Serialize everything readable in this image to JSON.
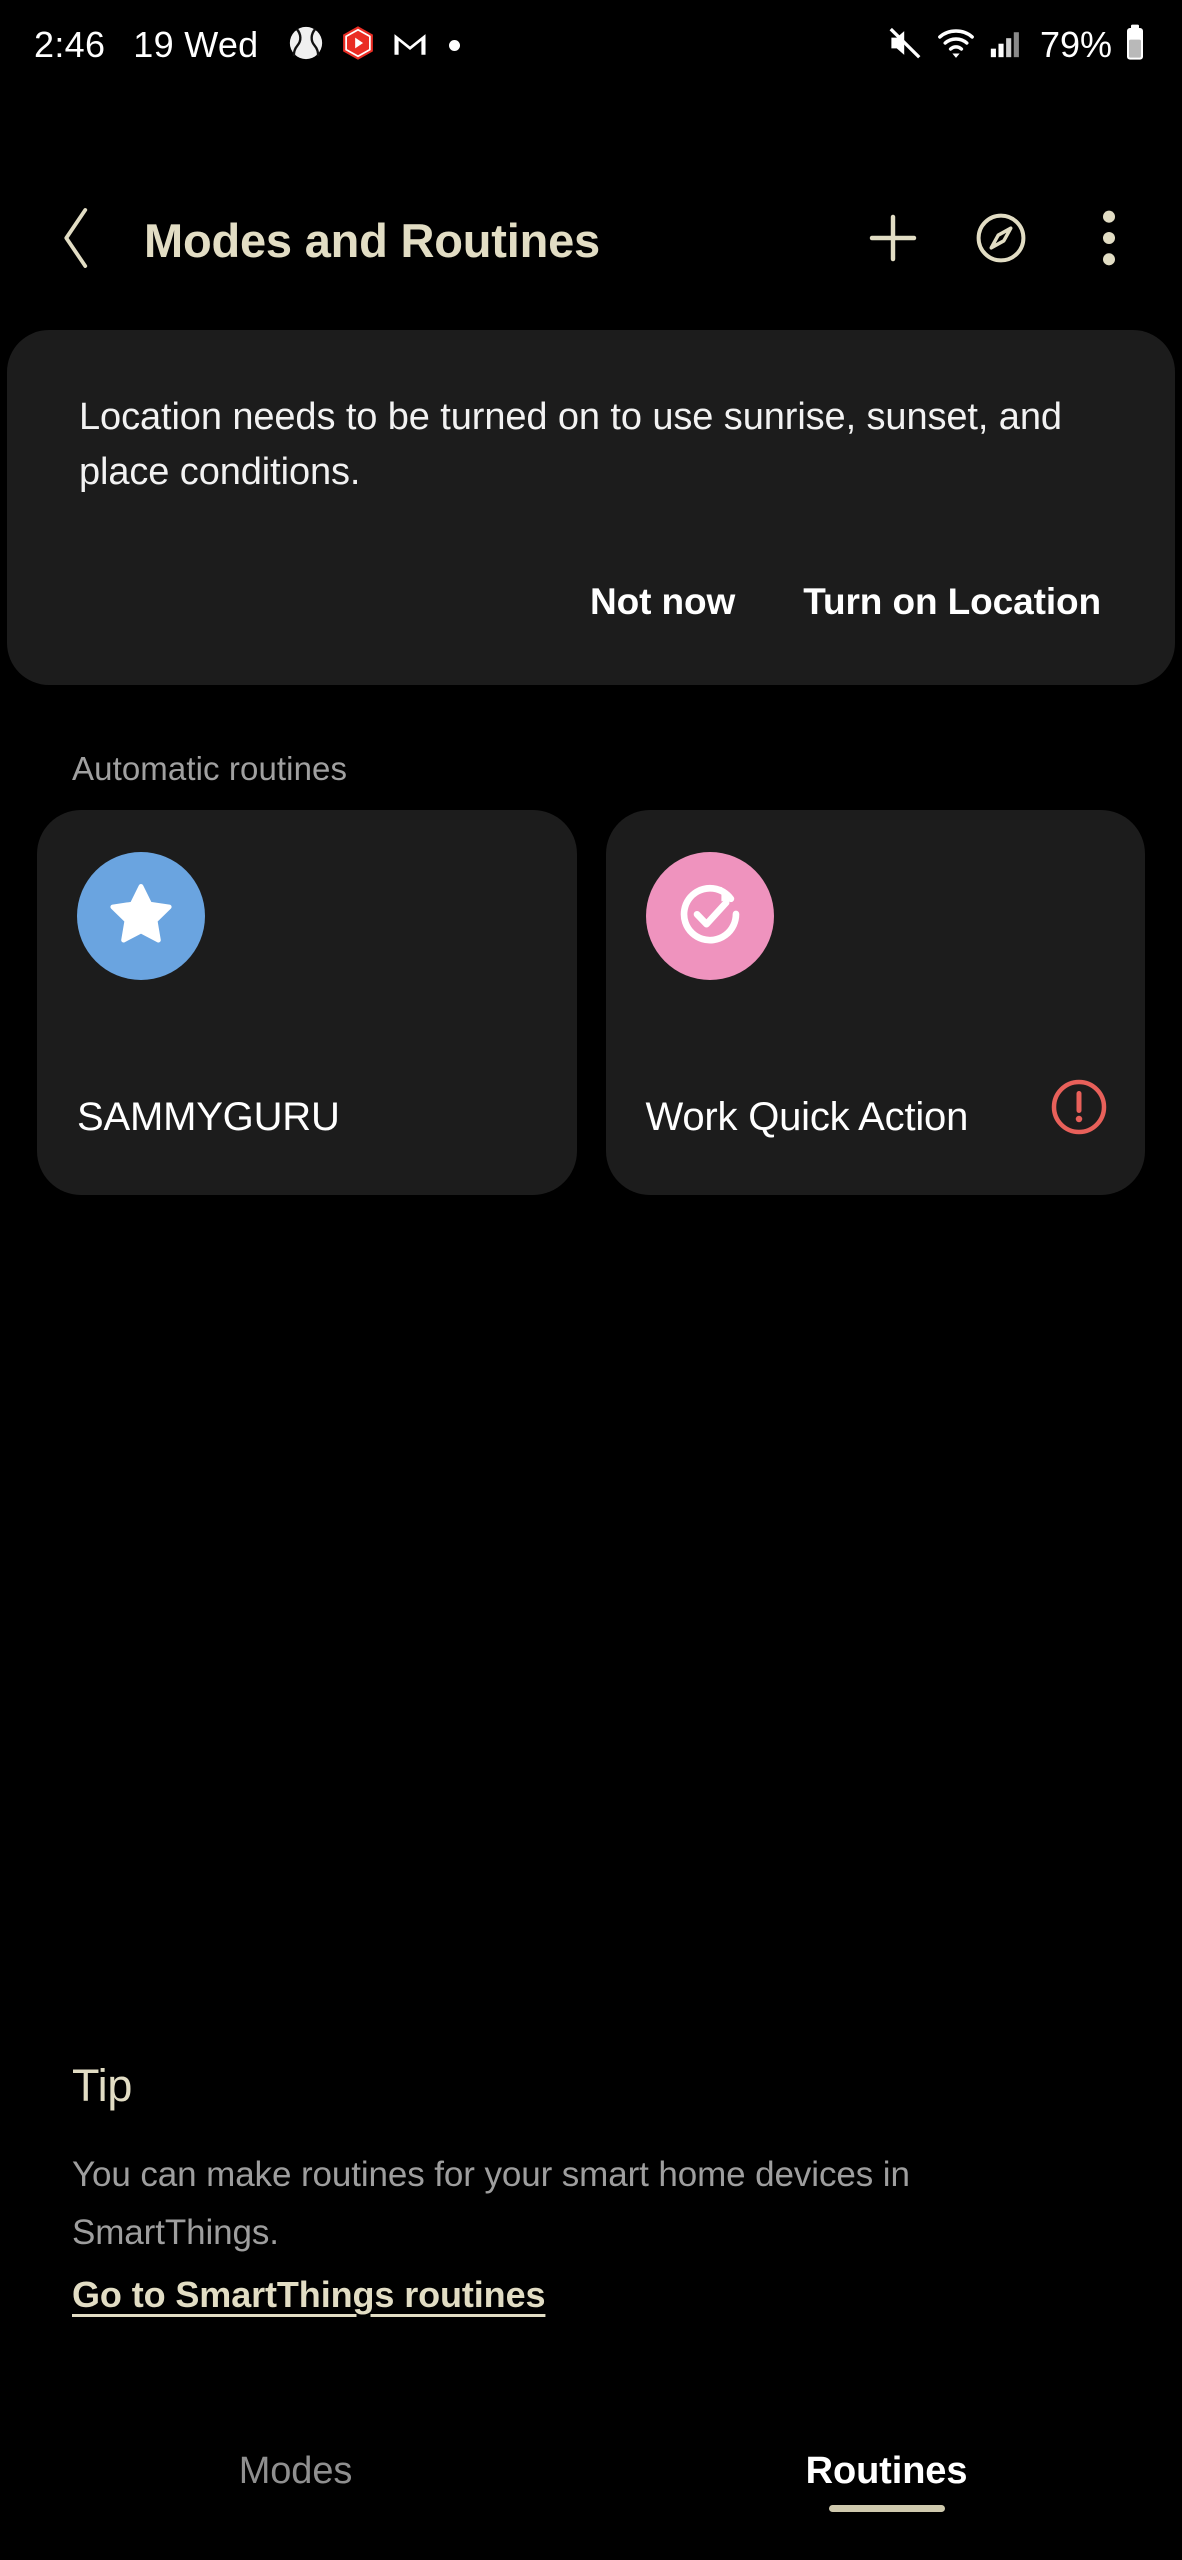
{
  "status_bar": {
    "time": "2:46",
    "date": "19 Wed",
    "battery_percent": "79%",
    "left_icons": [
      "sports-baseball-icon",
      "youtube-play-icon",
      "gmail-icon",
      "more-notifications-dot"
    ],
    "right_icons": [
      "mute-icon",
      "wifi-icon",
      "cellular-signal-icon",
      "battery-icon"
    ]
  },
  "header": {
    "title": "Modes and Routines",
    "back_icon": "chevron-left-icon",
    "add_icon": "plus-icon",
    "discover_icon": "compass-icon",
    "overflow_icon": "more-vertical-icon"
  },
  "location_card": {
    "message": "Location needs to be turned on to use sunrise, sunset, and place conditions.",
    "dismiss_label": "Not now",
    "confirm_label": "Turn on Location"
  },
  "section": {
    "automatic_routines_label": "Automatic routines"
  },
  "routines": [
    {
      "name": "SAMMYGURU",
      "icon": "star-icon",
      "avatar_color": "#6aa4e0",
      "has_warning": false
    },
    {
      "name": "Work Quick Action",
      "icon": "rotate-check-icon",
      "avatar_color": "#ef93be",
      "has_warning": true,
      "warning_color": "#e8605a"
    }
  ],
  "tip": {
    "title": "Tip",
    "body": "You can make routines for your smart home devices in SmartThings.",
    "link_label": "Go to SmartThings routines"
  },
  "tabs": [
    {
      "label": "Modes",
      "active": false
    },
    {
      "label": "Routines",
      "active": true
    }
  ],
  "colors": {
    "background": "#000000",
    "card": "#1c1c1c",
    "accent_cream": "#e2ddc4",
    "muted_text": "#9e9e9e"
  }
}
